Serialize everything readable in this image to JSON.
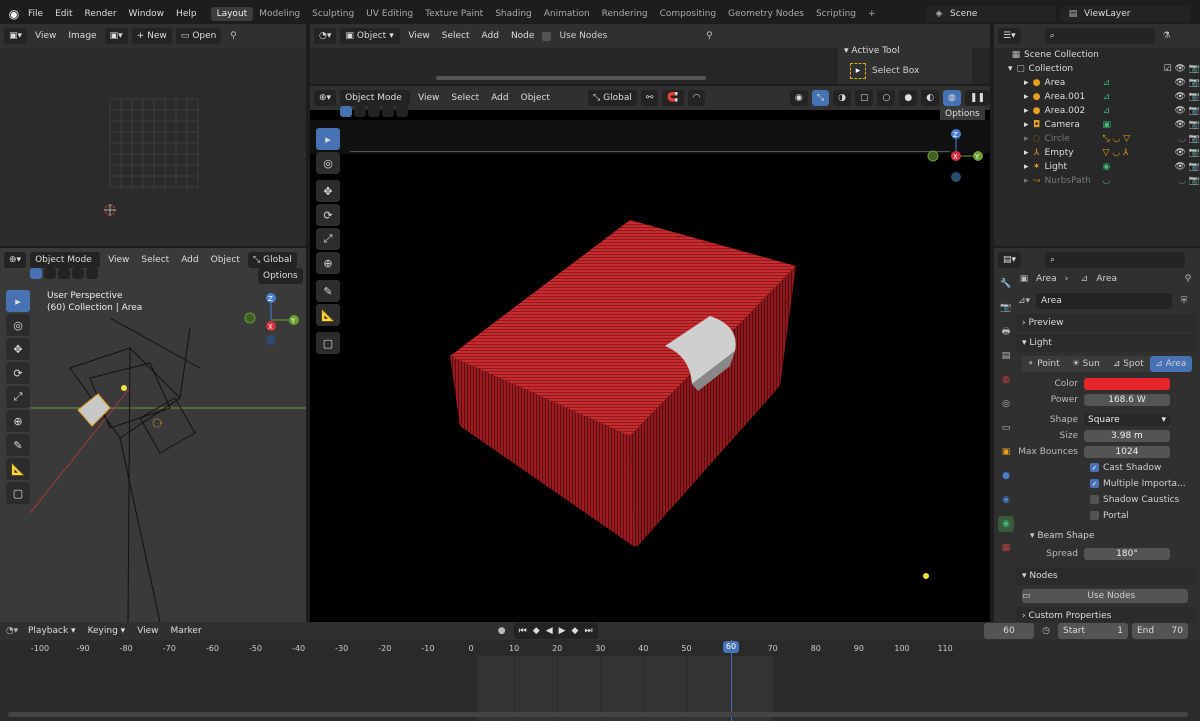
{
  "topbar": {
    "menus": [
      "File",
      "Edit",
      "Render",
      "Window",
      "Help"
    ],
    "workspaces": [
      "Layout",
      "Modeling",
      "Sculpting",
      "UV Editing",
      "Texture Paint",
      "Shading",
      "Animation",
      "Rendering",
      "Compositing",
      "Geometry Nodes",
      "Scripting"
    ],
    "add": "+",
    "scene": "Scene",
    "view_layer": "ViewLayer"
  },
  "image_editor": {
    "view": "View",
    "image": "Image",
    "new": "New",
    "open": "Open"
  },
  "node_editor": {
    "object": "Object",
    "view": "View",
    "select": "Select",
    "add": "Add",
    "node": "Node",
    "use_nodes": "Use Nodes",
    "active_tool_title": "Active Tool",
    "select_box": "Select Box"
  },
  "viewport_small": {
    "mode": "Object Mode",
    "view": "View",
    "select": "Select",
    "add": "Add",
    "object": "Object",
    "transform": "Global",
    "options": "Options",
    "perspective": "User Perspective",
    "collection": "(60) Collection | Area"
  },
  "viewport_main": {
    "mode": "Object Mode",
    "view": "View",
    "select": "Select",
    "add": "Add",
    "object": "Object",
    "transform": "Global",
    "options": "Options"
  },
  "gizmo": {
    "x": "X",
    "y": "Y",
    "z": "Z"
  },
  "outliner": {
    "scene_collection": "Scene Collection",
    "collection": "Collection",
    "items": [
      {
        "name": "Area",
        "dim": false
      },
      {
        "name": "Area.001",
        "dim": false
      },
      {
        "name": "Area.002",
        "dim": false
      },
      {
        "name": "Camera",
        "dim": false
      },
      {
        "name": "Circle",
        "dim": true
      },
      {
        "name": "Empty",
        "dim": false
      },
      {
        "name": "Light",
        "dim": false
      },
      {
        "name": "NurbsPath",
        "dim": true
      }
    ]
  },
  "properties": {
    "breadcrumb_1": "Area",
    "breadcrumb_2": "Area",
    "data_name": "Area",
    "preview": "Preview",
    "light": "Light",
    "light_types": [
      "Point",
      "Sun",
      "Spot",
      "Area"
    ],
    "active_type": "Area",
    "color_label": "Color",
    "color": "#e8262a",
    "power_label": "Power",
    "power": "168.6 W",
    "shape_label": "Shape",
    "shape": "Square",
    "size_label": "Size",
    "size": "3.98 m",
    "bounces_label": "Max Bounces",
    "bounces": "1024",
    "cast_shadow": "Cast Shadow",
    "multiple_importance": "Multiple Importa...",
    "shadow_caustics": "Shadow Caustics",
    "portal": "Portal",
    "beam_shape": "Beam Shape",
    "spread_label": "Spread",
    "spread": "180°",
    "nodes": "Nodes",
    "use_nodes": "Use Nodes",
    "custom_props": "Custom Properties"
  },
  "timeline": {
    "playback": "Playback",
    "keying": "Keying",
    "view": "View",
    "marker": "Marker",
    "current_frame": "60",
    "start_label": "Start",
    "start": "1",
    "end_label": "End",
    "end": "70",
    "ticks": [
      "-100",
      "-90",
      "-80",
      "-70",
      "-60",
      "-50",
      "-40",
      "-30",
      "-20",
      "-10",
      "0",
      "10",
      "20",
      "30",
      "40",
      "50",
      "60",
      "70",
      "80",
      "90",
      "100",
      "110"
    ],
    "playhead": "60"
  }
}
